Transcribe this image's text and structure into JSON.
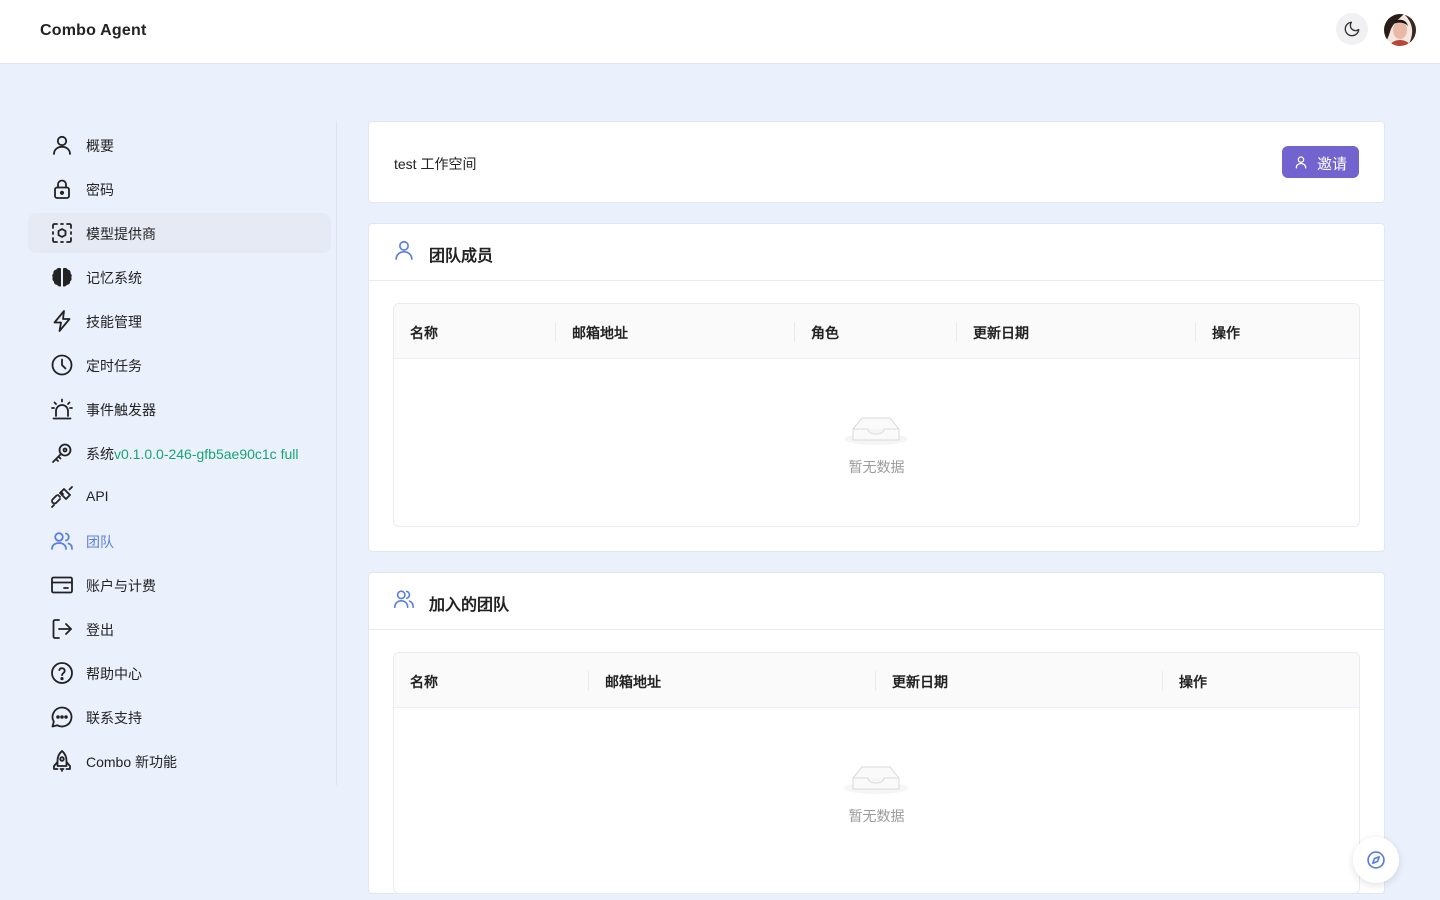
{
  "app": {
    "title": "Combo Agent"
  },
  "header": {
    "theme_icon": "moon-icon",
    "avatar_icon": "avatar"
  },
  "sidebar": {
    "items": [
      {
        "label": "概要",
        "icon": "user-icon"
      },
      {
        "label": "密码",
        "icon": "lock-icon"
      },
      {
        "label": "模型提供商",
        "icon": "model-provider-icon"
      },
      {
        "label": "记忆系统",
        "icon": "brain-icon"
      },
      {
        "label": "技能管理",
        "icon": "lightning-icon"
      },
      {
        "label": "定时任务",
        "icon": "clock-icon"
      },
      {
        "label": "事件触发器",
        "icon": "siren-icon"
      },
      {
        "label": "系统",
        "version": "v0.1.0.0-246-gfb5ae90c1c full",
        "icon": "key-icon"
      },
      {
        "label": "API",
        "icon": "plug-icon"
      },
      {
        "label": "团队",
        "icon": "users-icon"
      },
      {
        "label": "账户与计费",
        "icon": "credit-card-icon"
      },
      {
        "label": "登出",
        "icon": "logout-icon"
      },
      {
        "label": "帮助中心",
        "icon": "help-icon"
      },
      {
        "label": "联系支持",
        "icon": "chat-icon"
      },
      {
        "label": "Combo 新功能",
        "icon": "rocket-icon"
      }
    ],
    "selected_index": 2,
    "current_index": 9
  },
  "workspace": {
    "name": "test 工作空间",
    "invite_label": "邀请"
  },
  "members": {
    "title": "团队成员",
    "columns": [
      "名称",
      "邮箱地址",
      "角色",
      "更新日期",
      "操作"
    ],
    "rows": [],
    "empty_text": "暂无数据"
  },
  "joined": {
    "title": "加入的团队",
    "columns": [
      "名称",
      "邮箱地址",
      "更新日期",
      "操作"
    ],
    "rows": [],
    "empty_text": "暂无数据"
  },
  "colors": {
    "accent": "#7164cf",
    "active_nav": "#5b7fe0",
    "version": "#17a673",
    "background": "#ebf0fd"
  }
}
